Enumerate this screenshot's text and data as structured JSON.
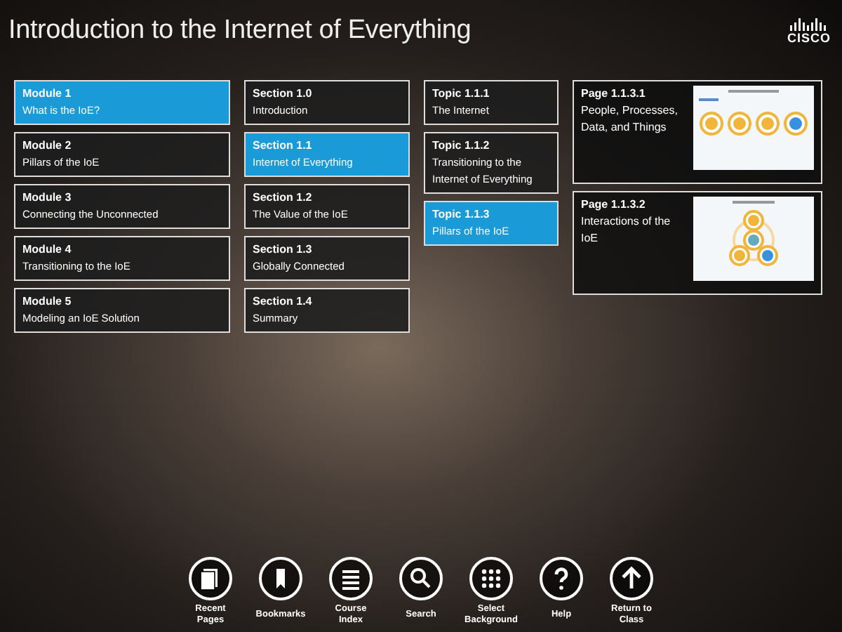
{
  "title": "Introduction to the Internet of Everything",
  "logo": "CISCO",
  "modules": [
    {
      "heading": "Module 1",
      "label": "What is the IoE?",
      "selected": true
    },
    {
      "heading": "Module 2",
      "label": "Pillars of the IoE",
      "selected": false
    },
    {
      "heading": "Module 3",
      "label": "Connecting the Unconnected",
      "selected": false
    },
    {
      "heading": "Module 4",
      "label": "Transitioning to the IoE",
      "selected": false
    },
    {
      "heading": "Module 5",
      "label": "Modeling an IoE Solution",
      "selected": false
    }
  ],
  "sections": [
    {
      "heading": "Section 1.0",
      "label": "Introduction",
      "selected": false
    },
    {
      "heading": "Section 1.1",
      "label": "Internet of Everything",
      "selected": true
    },
    {
      "heading": "Section 1.2",
      "label": "The Value of the IoE",
      "selected": false
    },
    {
      "heading": "Section 1.3",
      "label": "Globally Connected",
      "selected": false
    },
    {
      "heading": "Section 1.4",
      "label": "Summary",
      "selected": false
    }
  ],
  "topics": [
    {
      "heading": "Topic 1.1.1",
      "label": "The Internet",
      "selected": false
    },
    {
      "heading": "Topic 1.1.2",
      "label": "Transitioning to the Internet of Everything",
      "selected": false
    },
    {
      "heading": "Topic 1.1.3",
      "label": "Pillars of the IoE",
      "selected": true
    }
  ],
  "pages": [
    {
      "heading": "Page 1.1.3.1",
      "label": "People, Processes, Data, and Things",
      "kind": "row"
    },
    {
      "heading": "Page 1.1.3.2",
      "label": "Interactions of the IoE",
      "kind": "triangle"
    }
  ],
  "toolbar": [
    {
      "label": "Recent Pages",
      "kind": "pages"
    },
    {
      "label": "Bookmarks",
      "kind": "bookmark"
    },
    {
      "label": "Course Index",
      "kind": "list"
    },
    {
      "label": "Search",
      "kind": "search"
    },
    {
      "label": "Select Background",
      "kind": "grid"
    },
    {
      "label": "Help",
      "kind": "help"
    },
    {
      "label": "Return to Class",
      "kind": "up"
    }
  ]
}
